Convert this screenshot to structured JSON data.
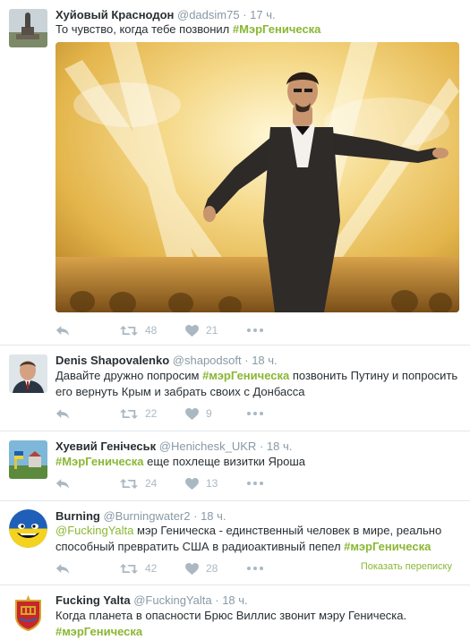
{
  "tweets": [
    {
      "name": "Хуйовый Краснодон",
      "handle": "@dadsim75",
      "dot": "·",
      "time": "17 ч.",
      "text_plain": "То чувство, когда тебе позвонил ",
      "hashtag": "#МэрГеническа",
      "retweets": "48",
      "likes": "21"
    },
    {
      "name": "Denis Shapovalenko",
      "handle": "@shapodsoft",
      "dot": "·",
      "time": "18 ч.",
      "text_before": "Давайте дружно попросим ",
      "hashtag": "#мэрГеническа",
      "text_after": " позвонить Путину и попросить его вернуть Крым и забрать своих с Донбасса",
      "retweets": "22",
      "likes": "9"
    },
    {
      "name": "Хуевий Генічеськ",
      "handle": "@Henichesk_UKR",
      "dot": "·",
      "time": "18 ч.",
      "hashtag": "#МэрГеническа",
      "text_after": " еще похлеще визитки Яроша",
      "retweets": "24",
      "likes": "13"
    },
    {
      "name": "Burning",
      "handle": "@Burningwater2",
      "dot": "·",
      "time": "18 ч.",
      "mention": "@FuckingYalta",
      "text_middle": " мэр Геническа - единственный человек в мире, реально способный превратить США в радиоактивный пепел ",
      "hashtag": "#мэрГеническа",
      "retweets": "42",
      "likes": "28",
      "show_conversation": "Показать переписку"
    },
    {
      "name": "Fucking Yalta",
      "handle": "@FuckingYalta",
      "dot": "·",
      "time": "18 ч.",
      "text_plain": "Когда планета в опасности Брюс Виллис звонит мэру Геническа.",
      "hashtag": "#мэрГеническа"
    }
  ],
  "icons": {
    "reply": "reply-icon",
    "retweet": "retweet-icon",
    "like": "heart-icon",
    "more": "more-icon"
  },
  "colors": {
    "hashtag": "#8ab734",
    "meta": "#8899a6",
    "action": "#aab8c2",
    "divider": "#e1e8ed"
  }
}
